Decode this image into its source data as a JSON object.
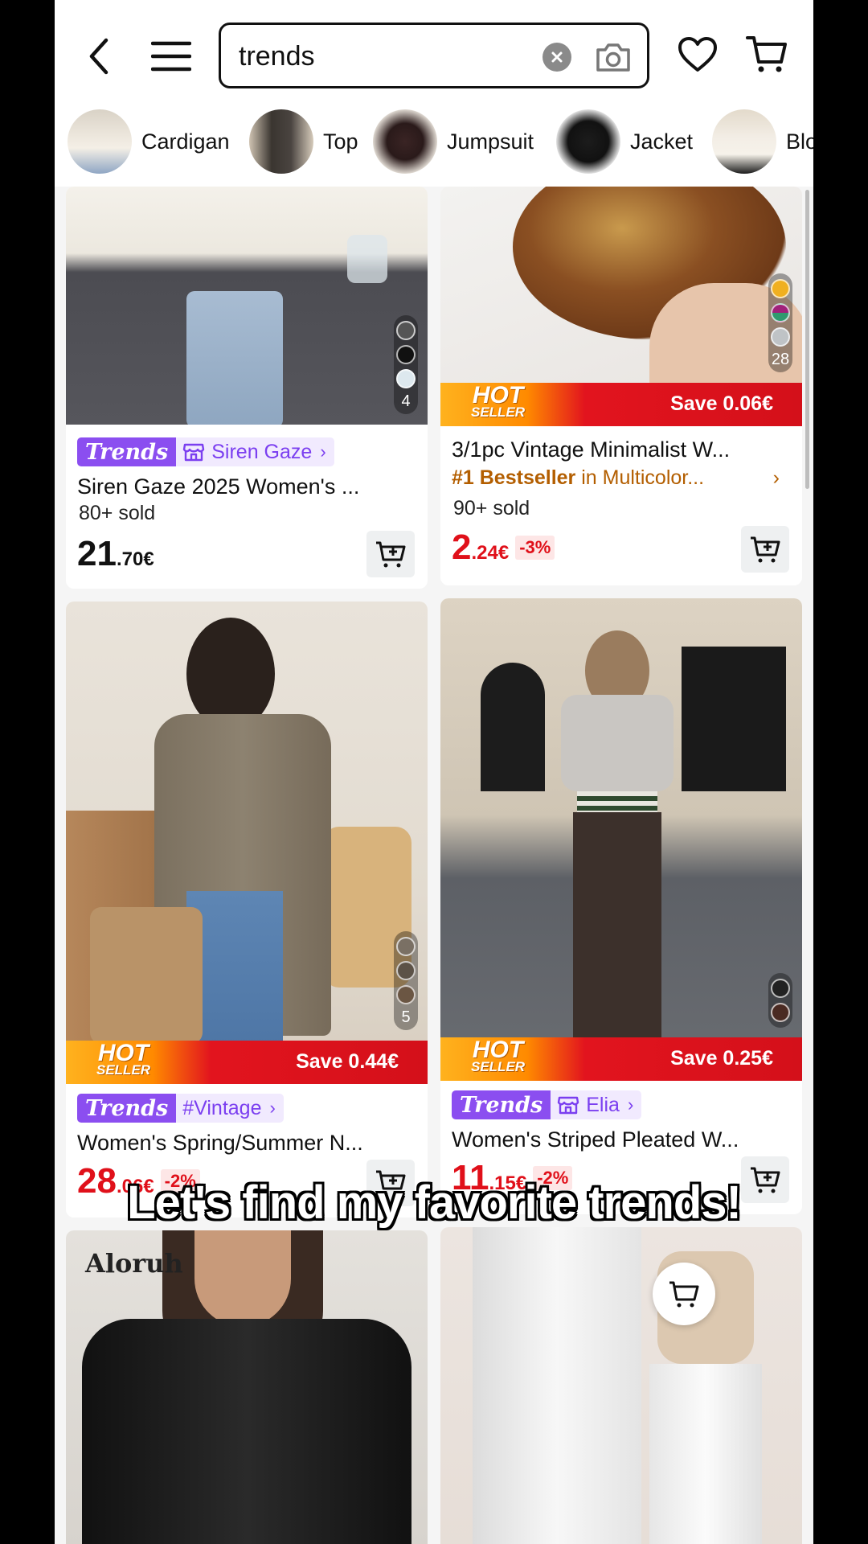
{
  "search": {
    "query": "trends"
  },
  "categories": [
    {
      "label": "Cardigan"
    },
    {
      "label": "Top"
    },
    {
      "label": "Jumpsuit"
    },
    {
      "label": "Jacket"
    },
    {
      "label": "Blo"
    }
  ],
  "products": [
    {
      "badge": "Trends",
      "store": "Siren Gaze",
      "title": "Siren Gaze 2025 Women's ...",
      "sold": "80+ sold",
      "price_int": "21",
      "price_dec": ".70€",
      "swatch_count": "4"
    },
    {
      "hot_top": "HOT",
      "hot_bottom": "SELLER",
      "save": "Save 0.06€",
      "title": "3/1pc Vintage Minimalist W...",
      "bestseller_rank": "#1 Bestseller",
      "bestseller_rest": " in Multicolor...",
      "sold": "90+ sold",
      "price_int": "2",
      "price_dec": ".24€",
      "discount": "-3%",
      "swatch_count": "28"
    },
    {
      "hot_top": "HOT",
      "hot_bottom": "SELLER",
      "save": "Save 0.44€",
      "badge": "Trends",
      "store": "#Vintage",
      "title": "Women's Spring/Summer N...",
      "price_int": "28",
      "price_dec": ".06€",
      "discount": "-2%",
      "swatch_count": "5"
    },
    {
      "hot_top": "HOT",
      "hot_bottom": "SELLER",
      "save": "Save 0.25€",
      "badge": "Trends",
      "store": "Elia",
      "title": "Women's Striped Pleated W...",
      "price_int": "11",
      "price_dec": ".15€",
      "discount": "-2%"
    },
    {
      "brand": "Aloruh"
    },
    {}
  ],
  "caption": "Let's find my favorite trends!",
  "colors": {
    "trends_purple": "#8b4ef0",
    "price_red": "#e0101a",
    "bestseller_orange": "#b35e00",
    "hot_orange": "#ff8a00",
    "hot_red": "#d4101a"
  },
  "icons": [
    "back-arrow-icon",
    "menu-icon",
    "clear-icon",
    "camera-icon",
    "heart-icon",
    "cart-icon",
    "add-to-cart-icon",
    "chevron-right-icon",
    "store-icon"
  ]
}
